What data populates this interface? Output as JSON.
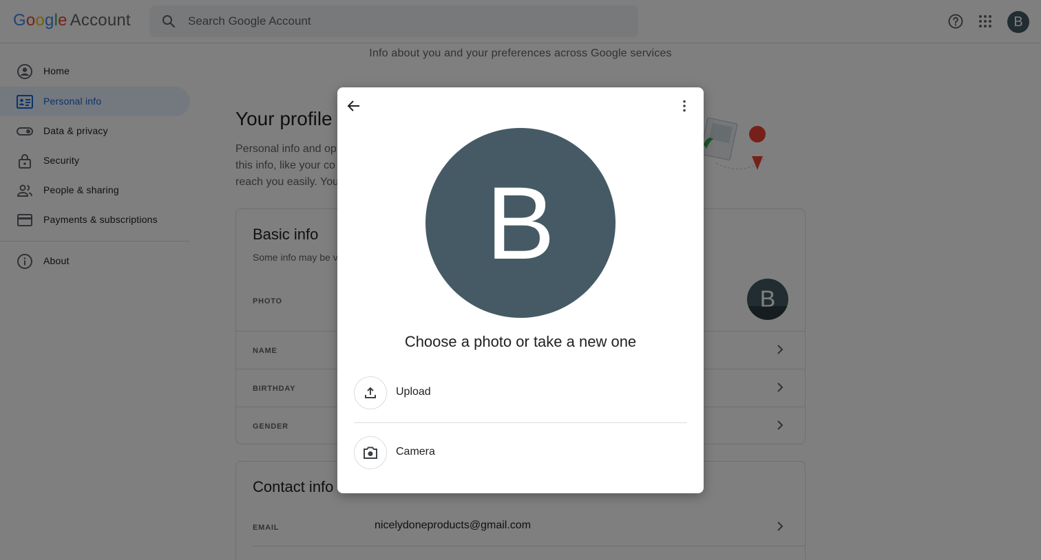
{
  "header": {
    "logo_google": "Google",
    "logo_account": "Account",
    "search_placeholder": "Search Google Account",
    "avatar_letter": "B"
  },
  "sidebar": {
    "items": [
      {
        "label": "Home",
        "icon": "account-circle-icon",
        "active": false
      },
      {
        "label": "Personal info",
        "icon": "id-card-icon",
        "active": true
      },
      {
        "label": "Data & privacy",
        "icon": "toggle-icon",
        "active": false
      },
      {
        "label": "Security",
        "icon": "lock-icon",
        "active": false
      },
      {
        "label": "People & sharing",
        "icon": "people-icon",
        "active": false
      },
      {
        "label": "Payments & subscriptions",
        "icon": "credit-card-icon",
        "active": false
      },
      {
        "label": "About",
        "icon": "info-icon",
        "active": false
      }
    ]
  },
  "main": {
    "subheading": "Info about you and your preferences across Google services",
    "profile_title": "Your profile",
    "profile_desc_1": "Personal info and op",
    "profile_desc_2": "this info, like your co",
    "profile_desc_3": "reach you easily. You"
  },
  "basic_info": {
    "title": "Basic info",
    "subtitle": "Some info may be v",
    "photo_label": "PHOTO",
    "photo_avatar_letter": "B",
    "name_label": "NAME",
    "birthday_label": "BIRTHDAY",
    "gender_label": "GENDER"
  },
  "contact_info": {
    "title": "Contact info",
    "email_label": "EMAIL",
    "email_value": "nicelydoneproducts@gmail.com"
  },
  "dialog": {
    "avatar_letter": "B",
    "title": "Choose a photo or take a new one",
    "upload_label": "Upload",
    "camera_label": "Camera"
  },
  "colors": {
    "avatar_bg": "#455a64",
    "active_nav_bg": "#e8f0fe",
    "active_nav_text": "#1967d2"
  }
}
